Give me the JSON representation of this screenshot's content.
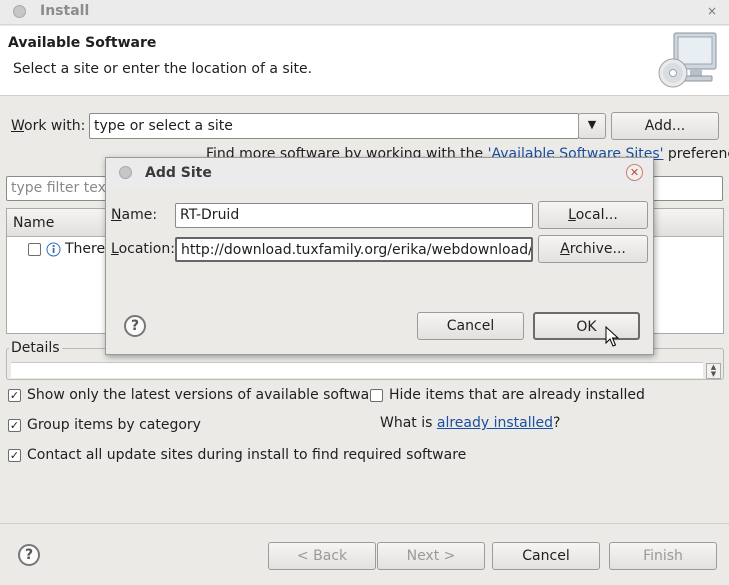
{
  "window": {
    "title": "Install",
    "close_glyph": "×"
  },
  "header": {
    "title": "Available Software",
    "subtitle": "Select a site or enter the location of a site.",
    "icon": "monitor-cd-icon"
  },
  "work_with": {
    "label": "Work with:",
    "value": "type or select a site",
    "add_label": "Add...",
    "find_more_prefix": "Find more software by working with the ",
    "find_more_link": "'Available Software Sites'",
    "find_more_suffix": " preferences."
  },
  "filter": {
    "placeholder": "type filter text"
  },
  "table": {
    "header_name": "Name",
    "row_text": "There"
  },
  "details": {
    "label": "Details"
  },
  "options": {
    "show_latest": "Show only the latest versions of available software",
    "hide_installed": "Hide items that are already installed",
    "group_by_category": "Group items by category",
    "what_is_prefix": "What is ",
    "already_installed_link": "already installed",
    "what_is_suffix": "?",
    "contact_sites": "Contact all update sites during install to find required software"
  },
  "footer": {
    "back_label": "< Back",
    "next_label": "Next >",
    "cancel_label": "Cancel",
    "finish_label": "Finish"
  },
  "dialog": {
    "title": "Add Site",
    "name_label": "Name:",
    "name_value": "RT-Druid",
    "local_label": "Local...",
    "location_label": "Location:",
    "location_value": "http://download.tuxfamily.org/erika/webdownload/rtdru",
    "archive_label": "Archive...",
    "cancel_label": "Cancel",
    "ok_label": "OK"
  }
}
